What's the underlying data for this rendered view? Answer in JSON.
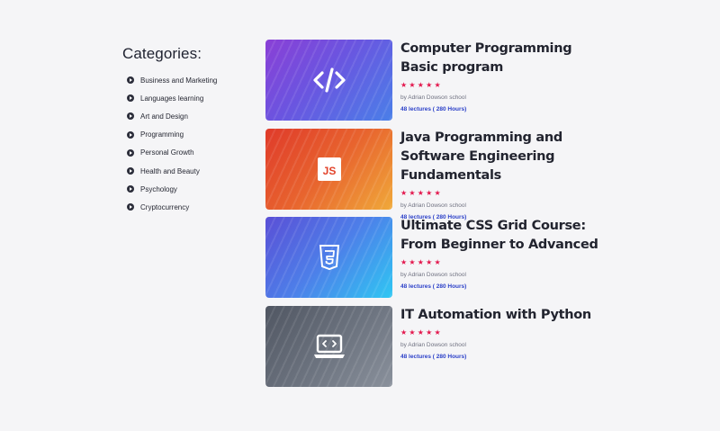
{
  "sidebar": {
    "title": "Categories:",
    "items": [
      {
        "label": "Business and Marketing"
      },
      {
        "label": "Languages learning"
      },
      {
        "label": "Art and Design"
      },
      {
        "label": "Programming"
      },
      {
        "label": "Personal Growth"
      },
      {
        "label": "Health and Beauty"
      },
      {
        "label": "Psychology"
      },
      {
        "label": "Cryptocurrency"
      }
    ]
  },
  "courses": [
    {
      "title": "Computer Programming Basic program",
      "stars": "★★★★★",
      "rating": 5,
      "author": "by Adrian Dowson school",
      "lectures": "48 lectures ( 280 Hours)",
      "icon": "code-brackets-icon",
      "gradient": [
        "#7b47d9",
        "#4f72e6"
      ]
    },
    {
      "title": "Java Programming and Software Engineering Fundamentals",
      "stars": "★★★★★",
      "rating": 5,
      "author": "by Adrian Dowson school",
      "lectures": "48 lectures ( 280 Hours)",
      "icon": "js-badge-icon",
      "icon_text": "JS",
      "gradient": [
        "#e2432a",
        "#f0a83a"
      ]
    },
    {
      "title": "Ultimate CSS Grid Course: From Beginner to Advanced",
      "stars": "★★★★★",
      "rating": 5,
      "author": "by Adrian Dowson school",
      "lectures": "48 lectures ( 280 Hours)",
      "icon": "css3-shield-icon",
      "gradient": [
        "#5b55d8",
        "#2fc2f2"
      ]
    },
    {
      "title": "IT Automation with Python",
      "stars": "★★★★★",
      "rating": 5,
      "author": "by Adrian Dowson school",
      "lectures": "48 lectures ( 280 Hours)",
      "icon": "laptop-code-icon",
      "gradient": [
        "#4d5360",
        "#7b838f"
      ]
    }
  ]
}
